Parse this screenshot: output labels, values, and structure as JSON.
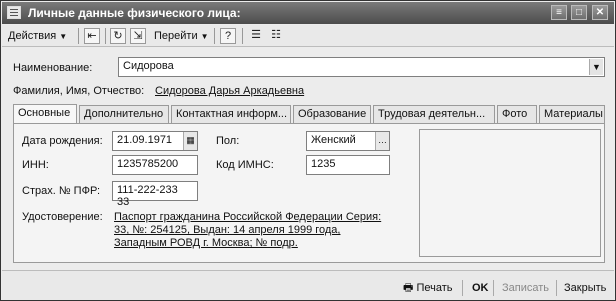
{
  "window": {
    "title": "Личные данные физического лица:"
  },
  "toolbar": {
    "actions_label": "Действия",
    "goto_label": "Перейти",
    "help_label": "?"
  },
  "header": {
    "name_label": "Наименование:",
    "name_value": "Сидорова",
    "fio_label": "Фамилия, Имя, Отчество:",
    "fio_value": "Сидорова Дарья Аркадьевна"
  },
  "tabs": [
    {
      "label": "Основные"
    },
    {
      "label": "Дополнительно"
    },
    {
      "label": "Контактная информ..."
    },
    {
      "label": "Образование"
    },
    {
      "label": "Трудовая деятельн..."
    },
    {
      "label": "Фото"
    },
    {
      "label": "Материалы"
    }
  ],
  "form": {
    "birthdate_label": "Дата рождения:",
    "birthdate_value": "21.09.1971",
    "gender_label": "Пол:",
    "gender_value": "Женский",
    "inn_label": "ИНН:",
    "inn_value": "1235785200",
    "imns_label": "Код ИМНС:",
    "imns_value": "1235",
    "pfr_label": "Страх. № ПФР:",
    "pfr_value": "111-222-233 33",
    "id_label": "Удостоверение:",
    "id_line1": "Паспорт гражданина Российской Федерации Серия:",
    "id_line2": "33, №: 254125, Выдан: 14 апреля 1999 года,",
    "id_line3": "Западным РОВД г. Москва; № подр."
  },
  "bottom": {
    "print_label": "Печать",
    "ok_label": "OK",
    "save_label": "Записать",
    "close_label": "Закрыть"
  }
}
